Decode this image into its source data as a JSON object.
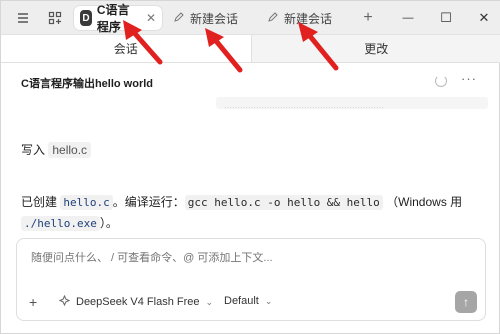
{
  "titlebar": {
    "tabs": [
      {
        "badge": "D",
        "label": "C语言程序",
        "close": "✕",
        "active": true
      },
      {
        "label": "新建会话",
        "active": false
      },
      {
        "label": "新建会话",
        "active": false
      }
    ],
    "new_tab_label": "+",
    "controls": {
      "minimize": "—",
      "maximize": "☐",
      "close": "✕"
    }
  },
  "subtabs": {
    "conversation": "会话",
    "changes": "更改"
  },
  "conversation": {
    "title": "C语言程序输出hello world",
    "more": "···",
    "faded_text": "……………………………………………………"
  },
  "messages": {
    "m1_prefix": "写入",
    "m1_file": "hello.c",
    "m2_created": "已创建",
    "m2_file": "hello.c",
    "m2_mid": "。编译运行：",
    "m2_cmd": "gcc hello.c -o hello && hello",
    "m2_os": "（Windows 用",
    "m2_exe": "./hello.exe",
    "m2_end": "）。"
  },
  "composer": {
    "placeholder": "随便问点什么、 / 可查看命令、@ 可添加上下文...",
    "plus": "+",
    "model": "DeepSeek V4 Flash Free",
    "mode": "Default",
    "send": "↑"
  },
  "colors": {
    "accent": "#e0211f",
    "send_button": "#a6a6a6"
  }
}
